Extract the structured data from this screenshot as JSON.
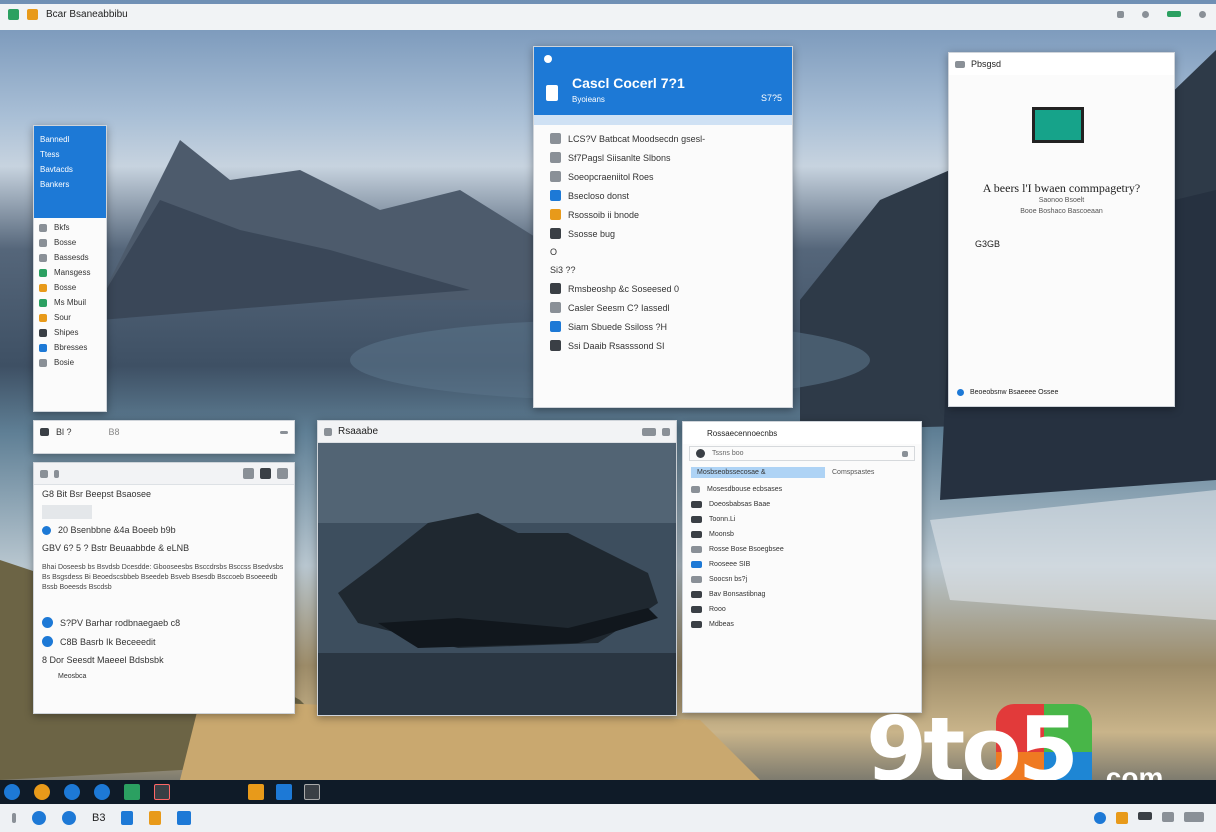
{
  "top_bar": {
    "title": "Bcar Bsaneabbibu"
  },
  "left_menu": {
    "header_items": [
      "Bannedl",
      "Ttess",
      "Bavtacds",
      "Bankers"
    ],
    "items": [
      "Bkfs",
      "Bosse",
      "Bassesds",
      "Mansgess",
      "Bosse",
      "Ms Mbuil",
      "Sour",
      "Shipes",
      "Bbresses",
      "Bosie"
    ]
  },
  "center_panel": {
    "title": "Cascl Cocerl 7?1",
    "subtitle": "Byoieans",
    "right_label": "S7?5",
    "items": [
      "LCS?V Batbcat Moodsecdn gsesl-",
      "Sf7Pagsl Siisanlte Slbons",
      "Soeopcraeniitol Roes",
      "Bsecloso donst",
      "Rsossoib ii bnode",
      "Ssosse bug",
      "O",
      "Si3 ??",
      "Rmsbeoshp &c Soseesed 0",
      "Casler Seesm C? Iassedl",
      "Siam Sbuede Ssiloss ?H",
      "Ssi Daaib Rsasssond SI"
    ]
  },
  "right_panel": {
    "title": "Pbsgsd",
    "question": "A beers l'I bwaen commpagetry?",
    "sub_lines": [
      "Saonoo Bsoelt",
      "Booe Boshaco Bascoeaan"
    ],
    "value": "G3GB",
    "footer": "Beoeobsnw Bsaeeee Ossee"
  },
  "small_bar": {
    "label": "Bl ?",
    "sub": "B8"
  },
  "doc_window": {
    "items": [
      "G8 Bit Bsr Beepst Bsaosee",
      "20 Bsenbbne &4a Boeeb b9b",
      "GBV 6? 5 ? Bstr Beuaabbde & eLNB"
    ],
    "paragraph": "Bhai Doseesb bs Bsvdsb Dcesdde: Gbooseesbs Bsccdrsbs Bsccss Bsedvsbs Bs Bsgsdess Bi Beoedscsbbeb Bseedeb Bsveb Bsesdb Bsccoeb Bsoeeedb Bssb Boeesds Bscdsb",
    "blue_item": "S?PV Barhar rodbnaegaeb c8",
    "item2": "C8B Basrb Ik Beceeedit",
    "item3": "8 Dor Seesdt Maeeel Bdsbsbk",
    "item3_sub": "Meosbca"
  },
  "photo_window": {
    "title": "Rsaaabe"
  },
  "settings_window": {
    "title": "Rossaecennoecnbs",
    "search": "Tssns boo",
    "selected": "Mosbseobssecosae &",
    "selected_right": "Comspsastes",
    "items": [
      "Mosesdbouse ecbsases",
      "Doeosbabsas Baae",
      "Toonn.Li",
      "Moonsb",
      "Rosse Bose Bsoegbsee",
      "Rooseee SIB",
      "Soocsn bs?j",
      "Bav Bonsastibnag",
      "Rooo",
      "Mdbeas"
    ]
  },
  "watermark": {
    "brand": "9to5",
    "suffix": ".com"
  },
  "taskbar": {
    "label": "B3"
  },
  "colors": {
    "accent": "#1d79d6",
    "taskbar": "#0f1b28",
    "watermark_green": "#48b648",
    "watermark_orange": "#ef7a22",
    "watermark_blue": "#1e86d4"
  }
}
